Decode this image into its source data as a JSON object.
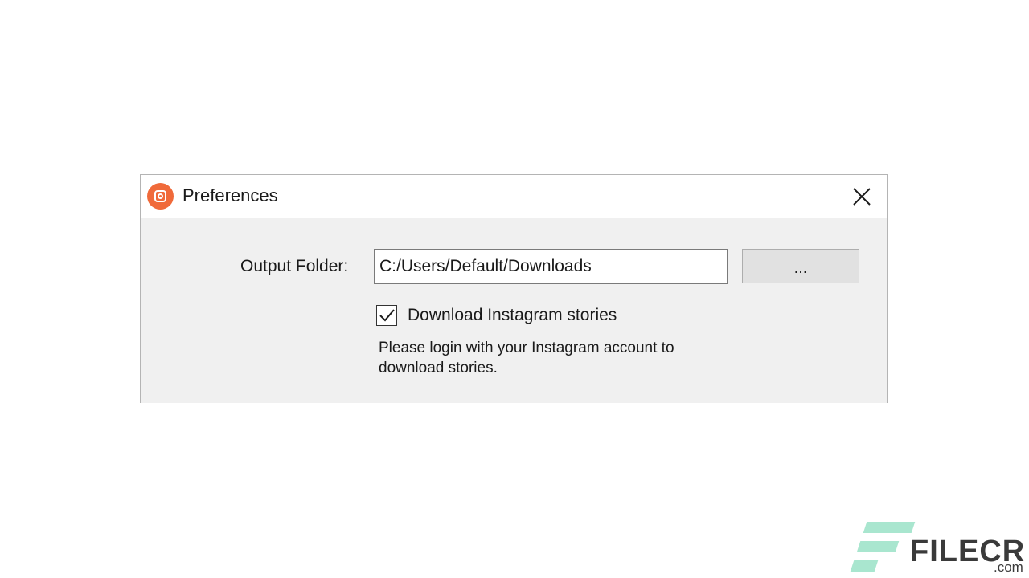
{
  "dialog": {
    "title": "Preferences",
    "app_icon": "instagram-camera-icon",
    "close_icon": "close-icon"
  },
  "form": {
    "output_folder_label": "Output Folder:",
    "output_folder_value": "C:/Users/Default/Downloads",
    "browse_label": "...",
    "download_stories_label": "Download Instagram stories",
    "download_stories_checked": true,
    "login_note": "Please login with your Instagram account to download stories."
  },
  "watermark": {
    "brand": "FILECR",
    "suffix": ".com",
    "accent_color": "#a9e6cf"
  },
  "colors": {
    "app_icon": "#f06a3a",
    "dialog_body": "#f0f0f0",
    "titlebar": "#ffffff"
  }
}
